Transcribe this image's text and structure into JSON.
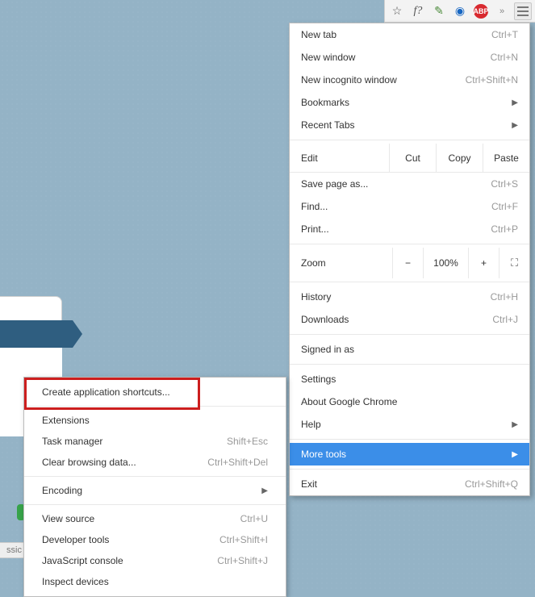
{
  "toolbar": {
    "star": "☆",
    "fq": "f?",
    "eyedrop": "✎",
    "blue": "◉",
    "abp": "ABP",
    "more": "»"
  },
  "menu": {
    "new_tab": {
      "label": "New tab",
      "shortcut": "Ctrl+T"
    },
    "new_window": {
      "label": "New window",
      "shortcut": "Ctrl+N"
    },
    "new_incognito": {
      "label": "New incognito window",
      "shortcut": "Ctrl+Shift+N"
    },
    "bookmarks": {
      "label": "Bookmarks"
    },
    "recent_tabs": {
      "label": "Recent Tabs"
    },
    "edit": {
      "label": "Edit",
      "cut": "Cut",
      "copy": "Copy",
      "paste": "Paste"
    },
    "save_page": {
      "label": "Save page as...",
      "shortcut": "Ctrl+S"
    },
    "find": {
      "label": "Find...",
      "shortcut": "Ctrl+F"
    },
    "print": {
      "label": "Print...",
      "shortcut": "Ctrl+P"
    },
    "zoom": {
      "label": "Zoom",
      "minus": "−",
      "value": "100%",
      "plus": "+"
    },
    "history": {
      "label": "History",
      "shortcut": "Ctrl+H"
    },
    "downloads": {
      "label": "Downloads",
      "shortcut": "Ctrl+J"
    },
    "signed_in": {
      "label": "Signed in as"
    },
    "settings": {
      "label": "Settings"
    },
    "about": {
      "label": "About Google Chrome"
    },
    "help": {
      "label": "Help"
    },
    "more_tools": {
      "label": "More tools"
    },
    "exit": {
      "label": "Exit",
      "shortcut": "Ctrl+Shift+Q"
    }
  },
  "submenu": {
    "create_shortcuts": {
      "label": "Create application shortcuts..."
    },
    "extensions": {
      "label": "Extensions"
    },
    "task_manager": {
      "label": "Task manager",
      "shortcut": "Shift+Esc"
    },
    "clear_data": {
      "label": "Clear browsing data...",
      "shortcut": "Ctrl+Shift+Del"
    },
    "encoding": {
      "label": "Encoding"
    },
    "view_source": {
      "label": "View source",
      "shortcut": "Ctrl+U"
    },
    "dev_tools": {
      "label": "Developer tools",
      "shortcut": "Ctrl+Shift+I"
    },
    "js_console": {
      "label": "JavaScript console",
      "shortcut": "Ctrl+Shift+J"
    },
    "inspect_devices": {
      "label": "Inspect devices"
    }
  },
  "page": {
    "ssic": "ssic"
  }
}
